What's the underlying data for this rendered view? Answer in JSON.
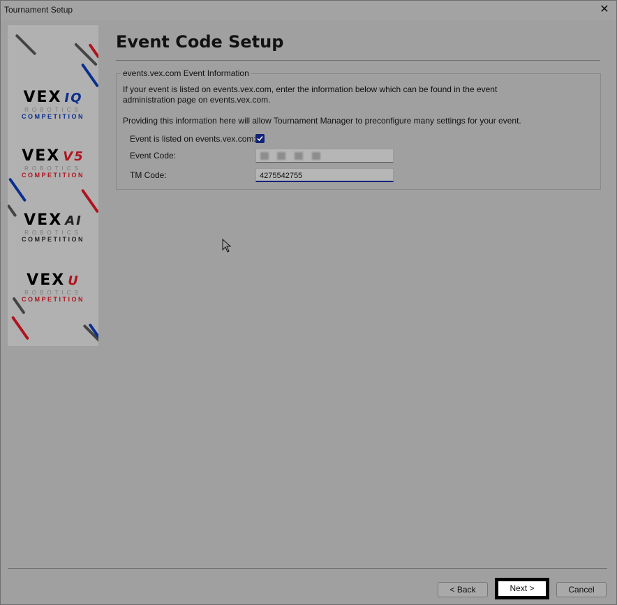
{
  "window": {
    "title": "Tournament Setup",
    "close_glyph": "✕"
  },
  "banner": {
    "logos": [
      {
        "word": "VEX",
        "suffix": "IQ",
        "robotics": "ROBOTICS",
        "competition": "COMPETITION",
        "suffix_color": "#0a2f8f"
      },
      {
        "word": "VEX",
        "suffix": "V5",
        "robotics": "ROBOTICS",
        "competition": "COMPETITION",
        "suffix_color": "#b0141e"
      },
      {
        "word": "VEX",
        "suffix": "AI",
        "robotics": "ROBOTICS",
        "competition": "COMPETITION",
        "suffix_color": "#222222"
      },
      {
        "word": "VEX",
        "suffix": "U",
        "robotics": "ROBOTICS",
        "competition": "COMPETITION",
        "suffix_color": "#b0141e"
      }
    ]
  },
  "page": {
    "title": "Event Code Setup",
    "group_label": "events.vex.com Event Information",
    "desc_line1": "If your event is listed on events.vex.com, enter the information below which can be found in the event",
    "desc_line2": "administration page on events.vex.com.",
    "desc_line3": "Providing this information here will allow Tournament Manager to preconfigure many settings for your event."
  },
  "form": {
    "listed_label": "Event is listed on events.vex.com:",
    "listed_checked": true,
    "event_code_label": "Event Code:",
    "tm_code_label": "TM Code:",
    "tm_code_value": "4275542755"
  },
  "buttons": {
    "back": "< Back",
    "next": "Next >",
    "cancel": "Cancel"
  },
  "colors": {
    "accent": "#12237a",
    "red": "#b0141e",
    "blue": "#0a2f8f"
  }
}
